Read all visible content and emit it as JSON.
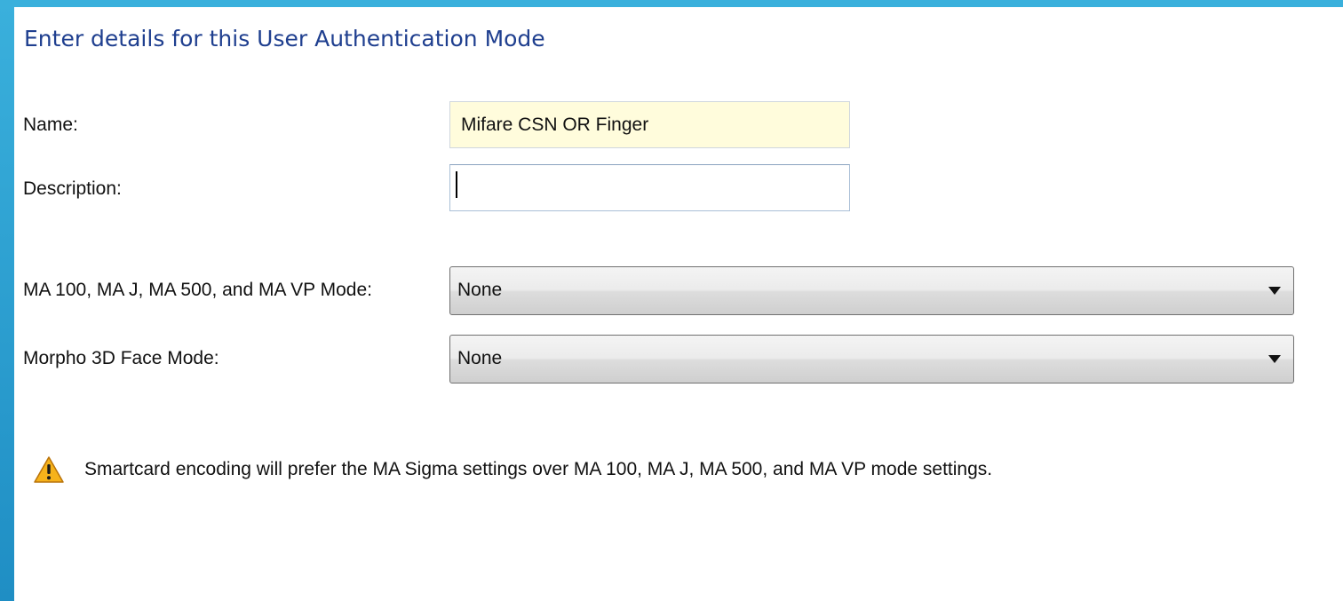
{
  "header": {
    "title": "Enter details for this User Authentication Mode"
  },
  "form": {
    "name": {
      "label": "Name:",
      "value": "Mifare CSN OR Finger"
    },
    "description": {
      "label": "Description:",
      "value": ""
    },
    "ma_mode": {
      "label": "MA 100, MA J, MA 500, and MA VP Mode:",
      "selected": "None"
    },
    "morpho_face_mode": {
      "label": "Morpho 3D Face Mode:",
      "selected": "None"
    }
  },
  "warning": {
    "icon": "warning-icon",
    "text": "Smartcard encoding will prefer the MA Sigma settings over MA 100, MA J, MA 500, and MA VP mode settings."
  },
  "colors": {
    "heading": "#1f3f8f",
    "frame_accent": "#2a9fd3",
    "name_field_background": "#fffcdc",
    "warning_fill": "#f6b21b"
  }
}
